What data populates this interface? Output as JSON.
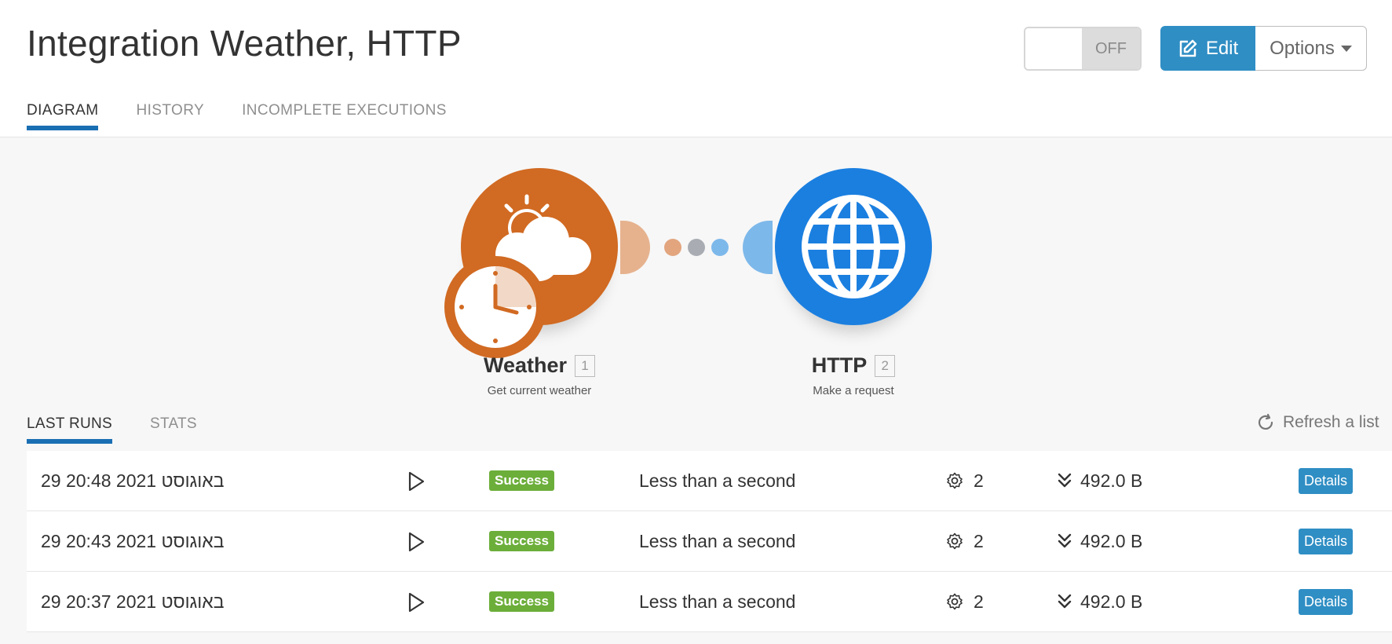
{
  "header": {
    "title": "Integration Weather, HTTP",
    "toggle_state": "OFF",
    "edit_label": "Edit",
    "options_label": "Options"
  },
  "tabs": [
    {
      "label": "DIAGRAM",
      "active": true
    },
    {
      "label": "HISTORY",
      "active": false
    },
    {
      "label": "INCOMPLETE EXECUTIONS",
      "active": false
    }
  ],
  "diagram": {
    "modules": [
      {
        "name": "Weather",
        "number": "1",
        "description": "Get current weather",
        "color": "#d16a22",
        "icon": "weather-clock-icon"
      },
      {
        "name": "HTTP",
        "number": "2",
        "description": "Make a request",
        "color": "#1b7fe0",
        "icon": "globe-icon"
      }
    ],
    "connector_colors": [
      "#e2a57e",
      "#a9adb3",
      "#7db8ea"
    ]
  },
  "runs_section": {
    "tabs": [
      {
        "label": "LAST RUNS",
        "active": true
      },
      {
        "label": "STATS",
        "active": false
      }
    ],
    "refresh_label": "Refresh a list",
    "runs": [
      {
        "date": "29 20:48 2021 באוגוסט",
        "status": "Success",
        "duration": "Less than a second",
        "operations": "2",
        "size": "492.0 B",
        "details_label": "Details"
      },
      {
        "date": "29 20:43 2021 באוגוסט",
        "status": "Success",
        "duration": "Less than a second",
        "operations": "2",
        "size": "492.0 B",
        "details_label": "Details"
      },
      {
        "date": "29 20:37 2021 באוגוסט",
        "status": "Success",
        "duration": "Less than a second",
        "operations": "2",
        "size": "492.0 B",
        "details_label": "Details"
      }
    ]
  },
  "colors": {
    "accent": "#2f8ec4",
    "tab_underline": "#1a6fb3",
    "success": "#6cae3a"
  }
}
